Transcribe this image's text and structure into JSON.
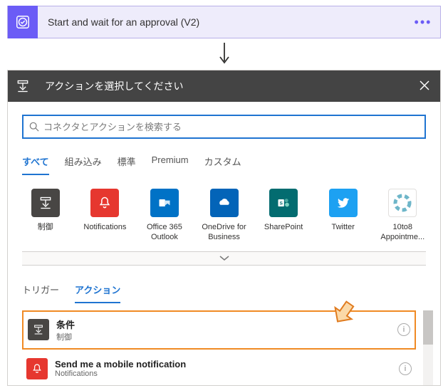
{
  "approvalStep": {
    "title": "Start and wait for an approval (V2)"
  },
  "picker": {
    "title": "アクションを選択してください",
    "search": {
      "placeholder": "コネクタとアクションを検索する"
    },
    "filterTabs": [
      "すべて",
      "組み込み",
      "標準",
      "Premium",
      "カスタム"
    ],
    "activeFilterIndex": 0,
    "connectors": [
      {
        "id": "control",
        "label": "制御",
        "color": "#484644"
      },
      {
        "id": "notifications",
        "label": "Notifications",
        "color": "#e6372f"
      },
      {
        "id": "o365outlook",
        "label": "Office 365 Outlook",
        "color": "#0072c6"
      },
      {
        "id": "onedrivebiz",
        "label": "OneDrive for Business",
        "color": "#0364b8"
      },
      {
        "id": "sharepoint",
        "label": "SharePoint",
        "color": "#036c70"
      },
      {
        "id": "twitter",
        "label": "Twitter",
        "color": "#1da1f2"
      },
      {
        "id": "10to8",
        "label": "10to8 Appointme...",
        "color": "#ffffff"
      }
    ],
    "subTabs": [
      "トリガー",
      "アクション"
    ],
    "activeSubIndex": 1,
    "actions": [
      {
        "title": "条件",
        "subtitle": "制御",
        "color": "#484644",
        "icon": "control"
      },
      {
        "title": "Send me a mobile notification",
        "subtitle": "Notifications",
        "color": "#e6372f",
        "icon": "bell"
      }
    ]
  }
}
